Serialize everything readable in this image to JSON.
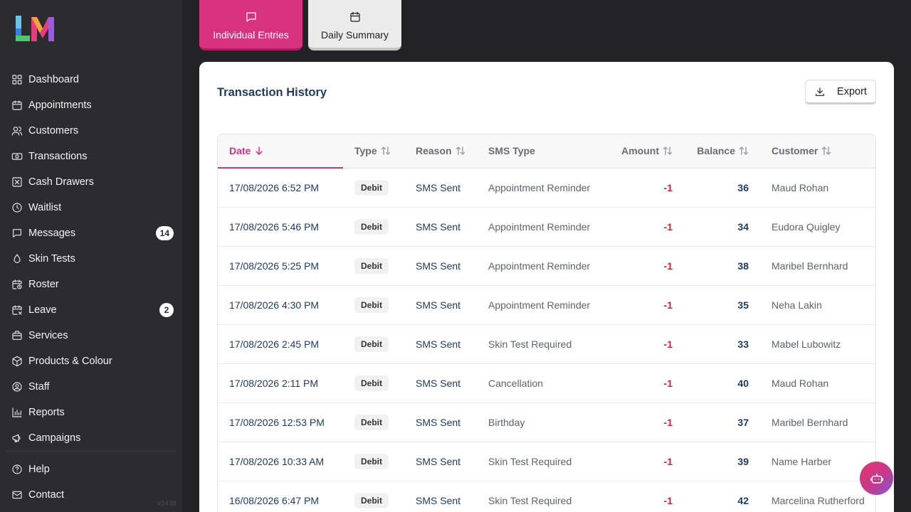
{
  "sidebar": {
    "items": [
      {
        "label": "Dashboard",
        "icon": "grid-icon"
      },
      {
        "label": "Appointments",
        "icon": "calendar-icon"
      },
      {
        "label": "Customers",
        "icon": "users-icon"
      },
      {
        "label": "Transactions",
        "icon": "cash-icon"
      },
      {
        "label": "Cash Drawers",
        "icon": "drawer-icon"
      },
      {
        "label": "Waitlist",
        "icon": "clock-icon"
      },
      {
        "label": "Messages",
        "icon": "message-icon",
        "badge": "14"
      },
      {
        "label": "Skin Tests",
        "icon": "drop-icon"
      },
      {
        "label": "Roster",
        "icon": "calendar-clock-icon"
      },
      {
        "label": "Leave",
        "icon": "calendar-off-icon",
        "badge": "2"
      },
      {
        "label": "Services",
        "icon": "briefcase-icon"
      },
      {
        "label": "Products & Colour",
        "icon": "box-icon"
      },
      {
        "label": "Staff",
        "icon": "user-circle-icon"
      },
      {
        "label": "Reports",
        "icon": "bar-chart-icon"
      },
      {
        "label": "Campaigns",
        "icon": "megaphone-icon"
      }
    ],
    "bottom_items": [
      {
        "label": "Help",
        "icon": "help-icon"
      },
      {
        "label": "Contact",
        "icon": "mail-icon"
      }
    ],
    "version": "v2438"
  },
  "tabs": {
    "individual": "Individual Entries",
    "daily": "Daily Summary"
  },
  "card": {
    "title": "Transaction History",
    "export_label": "Export"
  },
  "table": {
    "columns": {
      "date": "Date",
      "type": "Type",
      "reason": "Reason",
      "sms_type": "SMS Type",
      "amount": "Amount",
      "balance": "Balance",
      "customer": "Customer"
    },
    "rows": [
      {
        "date": "17/08/2026 6:52 PM",
        "type": "Debit",
        "reason": "SMS Sent",
        "sms_type": "Appointment Reminder",
        "amount": "-1",
        "balance": "36",
        "customer": "Maud Rohan"
      },
      {
        "date": "17/08/2026 5:46 PM",
        "type": "Debit",
        "reason": "SMS Sent",
        "sms_type": "Appointment Reminder",
        "amount": "-1",
        "balance": "34",
        "customer": "Eudora Quigley"
      },
      {
        "date": "17/08/2026 5:25 PM",
        "type": "Debit",
        "reason": "SMS Sent",
        "sms_type": "Appointment Reminder",
        "amount": "-1",
        "balance": "38",
        "customer": "Maribel Bernhard"
      },
      {
        "date": "17/08/2026 4:30 PM",
        "type": "Debit",
        "reason": "SMS Sent",
        "sms_type": "Appointment Reminder",
        "amount": "-1",
        "balance": "35",
        "customer": "Neha Lakin"
      },
      {
        "date": "17/08/2026 2:45 PM",
        "type": "Debit",
        "reason": "SMS Sent",
        "sms_type": "Skin Test Required",
        "amount": "-1",
        "balance": "33",
        "customer": "Mabel Lubowitz"
      },
      {
        "date": "17/08/2026 2:11 PM",
        "type": "Debit",
        "reason": "SMS Sent",
        "sms_type": "Cancellation",
        "amount": "-1",
        "balance": "40",
        "customer": "Maud Rohan"
      },
      {
        "date": "17/08/2026 12:53 PM",
        "type": "Debit",
        "reason": "SMS Sent",
        "sms_type": "Birthday",
        "amount": "-1",
        "balance": "37",
        "customer": "Maribel Bernhard"
      },
      {
        "date": "17/08/2026 10:33 AM",
        "type": "Debit",
        "reason": "SMS Sent",
        "sms_type": "Skin Test Required",
        "amount": "-1",
        "balance": "39",
        "customer": "Name Harber"
      },
      {
        "date": "16/08/2026 6:47 PM",
        "type": "Debit",
        "reason": "SMS Sent",
        "sms_type": "Skin Test Required",
        "amount": "-1",
        "balance": "42",
        "customer": "Marcelina Rutherford"
      }
    ]
  },
  "colors": {
    "accent": "#d8317e",
    "sidebar_bg": "#2c2c2e",
    "page_bg": "#232325",
    "negative": "#d0202c"
  }
}
